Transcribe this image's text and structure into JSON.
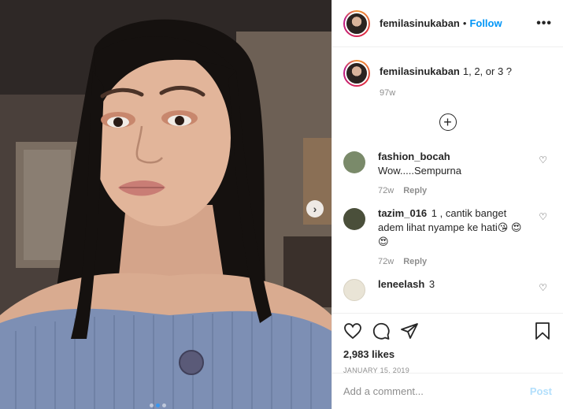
{
  "header": {
    "username": "femilasinukaban",
    "separator": "•",
    "follow_label": "Follow",
    "more_label": "•••"
  },
  "caption": {
    "username": "femilasinukaban",
    "text": "1, 2, or 3 ?",
    "time": "97w"
  },
  "load_more_label": "+",
  "comments": [
    {
      "username": "fashion_bocah",
      "text": "Wow.....Sempurna",
      "time": "72w",
      "reply_label": "Reply",
      "avatar_color": "#7a8a6a"
    },
    {
      "username": "tazim_016",
      "text": "1 , cantik banget adem lihat nyampe ke hati😘 😍😍",
      "time": "72w",
      "reply_label": "Reply",
      "avatar_color": "#4a4f3a"
    },
    {
      "username": "leneelash",
      "text": "3",
      "avatar_color": "#e9e4d6"
    }
  ],
  "actions": {
    "likes": "2,983 likes",
    "date": "JANUARY 15, 2019"
  },
  "add_comment": {
    "placeholder": "Add a comment...",
    "post_label": "Post"
  },
  "media": {
    "next_label": "›",
    "carousel_dots": 3,
    "active_dot": 1
  },
  "colors": {
    "link_blue": "#0095f6",
    "post_disabled": "#b2dffc",
    "meta_gray": "#8e8e8e"
  }
}
